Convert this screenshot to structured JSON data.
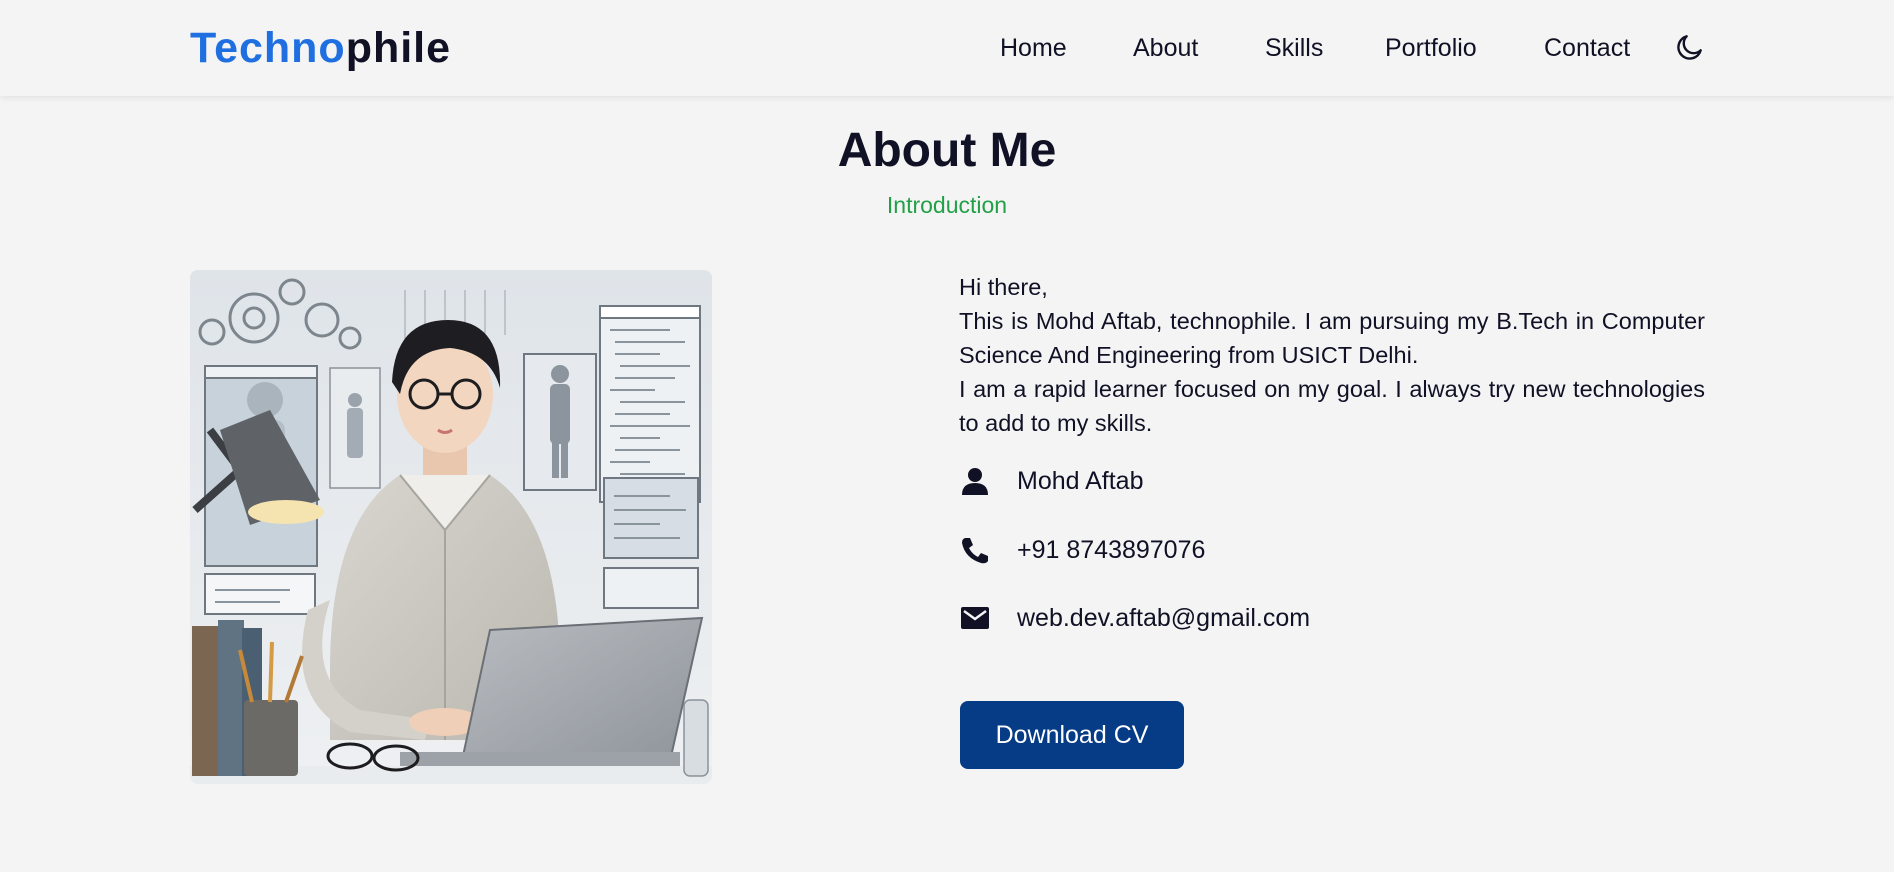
{
  "header": {
    "logo_part1": "Techno",
    "logo_part2": "phile",
    "nav": [
      {
        "label": "Home"
      },
      {
        "label": "About"
      },
      {
        "label": "Skills"
      },
      {
        "label": "Portfolio"
      },
      {
        "label": "Contact"
      }
    ],
    "theme_icon": "moon-icon"
  },
  "section": {
    "title": "About Me",
    "subtitle": "Introduction"
  },
  "intro": {
    "greeting": "Hi there,",
    "para1": "This is Mohd Aftab, technophile. I am pursuing my B.Tech in Computer Science And Engineering from USICT Delhi.",
    "para2": "I am a rapid learner focused on my goal. I always try new technologies to add to my skills."
  },
  "info": {
    "name": "Mohd Aftab",
    "phone": "+91 8743897076",
    "email": "web.dev.aftab@gmail.com"
  },
  "cv_button": "Download CV",
  "colors": {
    "logo_accent": "#1f6fe0",
    "subtitle": "#23a047",
    "button_bg": "#063b86",
    "background": "#f4f4f4"
  }
}
